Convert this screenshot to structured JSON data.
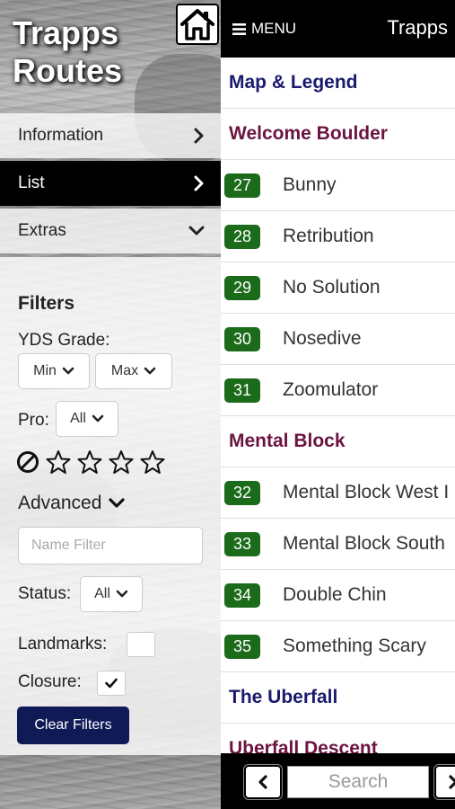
{
  "app": {
    "title_line1": "Trapps",
    "title_line2": "Routes"
  },
  "sidebar": {
    "items": [
      {
        "label": "Information",
        "icon": "chevron-right-icon"
      },
      {
        "label": "List",
        "icon": "chevron-right-icon",
        "active": true
      },
      {
        "label": "Extras",
        "icon": "chevron-down-icon"
      }
    ]
  },
  "filters": {
    "title": "Filters",
    "yds_label": "YDS Grade:",
    "min_label": "Min",
    "max_label": "Max",
    "pro_label": "Pro:",
    "pro_value": "All",
    "rating": {
      "max_stars": 4,
      "selected": 0
    },
    "advanced_label": "Advanced",
    "name_filter_placeholder": "Name Filter",
    "status_label": "Status:",
    "status_value": "All",
    "landmarks_label": "Landmarks:",
    "landmarks_checked": false,
    "closure_label": "Closure:",
    "closure_checked": true,
    "clear_label": "Clear Filters"
  },
  "topbar": {
    "menu_label": "MENU",
    "title": "Trapps"
  },
  "list": {
    "rows": [
      {
        "type": "header",
        "label": "Map & Legend",
        "color": "#1a1a6e"
      },
      {
        "type": "header",
        "label": "Welcome Boulder",
        "color": "#6b1440"
      },
      {
        "type": "route",
        "number": "27",
        "name": "Bunny"
      },
      {
        "type": "route",
        "number": "28",
        "name": "Retribution"
      },
      {
        "type": "route",
        "number": "29",
        "name": "No Solution"
      },
      {
        "type": "route",
        "number": "30",
        "name": "Nosedive"
      },
      {
        "type": "route",
        "number": "31",
        "name": "Zoomulator"
      },
      {
        "type": "header",
        "label": "Mental Block",
        "color": "#6b1440"
      },
      {
        "type": "route",
        "number": "32",
        "name": "Mental Block West I"
      },
      {
        "type": "route",
        "number": "33",
        "name": "Mental Block South"
      },
      {
        "type": "route",
        "number": "34",
        "name": "Double Chin"
      },
      {
        "type": "route",
        "number": "35",
        "name": "Something Scary"
      },
      {
        "type": "header",
        "label": "The Uberfall",
        "color": "#1a1a6e"
      },
      {
        "type": "header",
        "label": "Uberfall Descent",
        "color": "#6b1440"
      }
    ]
  },
  "bottombar": {
    "search_placeholder": "Search"
  },
  "colors": {
    "badge_green": "#1b6b1b",
    "clear_button": "#0f1a57",
    "header_navy": "#1a1a6e",
    "header_maroon": "#6b1440"
  }
}
